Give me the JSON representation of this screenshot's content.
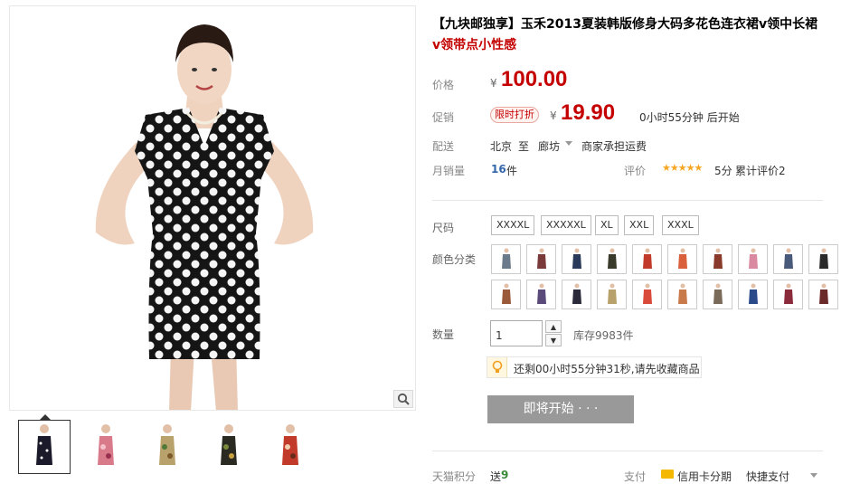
{
  "product": {
    "title_main": "【九块邮独享】玉禾2013夏装韩版修身大码多花色连衣裙v领中长裙",
    "title_sub": "v领带点小性感"
  },
  "price": {
    "label": "价格",
    "currency": "¥",
    "original": "100.00"
  },
  "promotion": {
    "label": "促销",
    "tag": "限时打折",
    "currency": "¥",
    "price": "19.90",
    "countdown": "0小时55分钟 后开始"
  },
  "delivery": {
    "label": "配送",
    "from": "北京",
    "to_word": "至",
    "to": "廊坊",
    "shipping": "商家承担运费"
  },
  "sales": {
    "label": "月销量",
    "count": "16",
    "unit": "件",
    "rating_label": "评价",
    "stars": "★★★★★",
    "score": "5分",
    "total_reviews": "累计评价2"
  },
  "sizes": {
    "label": "尺码",
    "options": [
      "XXXXL",
      "XXXXXL",
      "XL",
      "XXL",
      "XXXL"
    ]
  },
  "colors": {
    "label": "颜色分类"
  },
  "quantity": {
    "label": "数量",
    "value": "1",
    "up": "▲",
    "down": "▼",
    "stock": "库存9983件"
  },
  "tip": {
    "text": "还剩00小时55分钟31秒,请先收藏商品"
  },
  "action": {
    "coming_label": "即将开始 · · ·"
  },
  "footer": {
    "points_label": "天猫积分",
    "points_value_prefix": "送",
    "points_value": "9",
    "pay_label": "支付",
    "credit_card": "信用卡分期",
    "quick_pay": "快捷支付"
  },
  "colors_theme": {
    "accent_red": "#c40000",
    "star_orange": "#f5a623",
    "link_blue": "#3366aa"
  }
}
